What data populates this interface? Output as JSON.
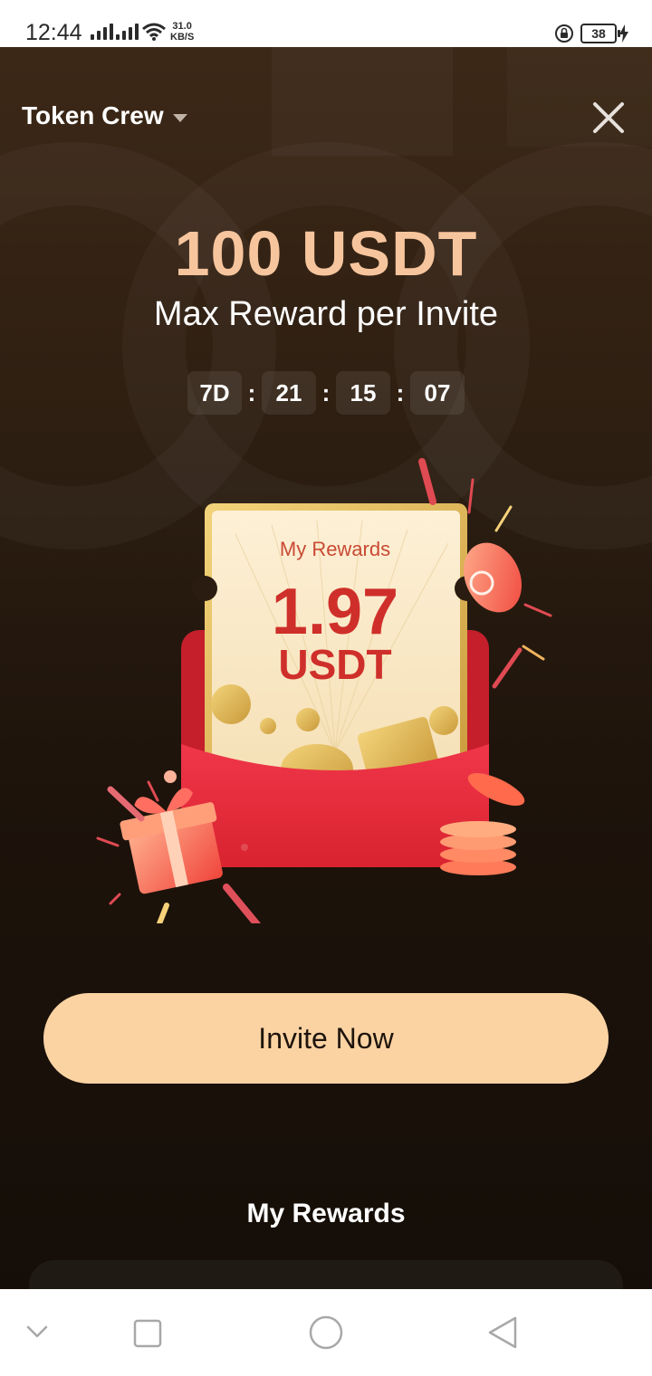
{
  "status_bar": {
    "time": "12:44",
    "speed_value": "31.0",
    "speed_unit": "KB/S",
    "battery": "38"
  },
  "header": {
    "title": "Token Crew"
  },
  "promo": {
    "headline": "100 USDT",
    "subline": "Max Reward per Invite"
  },
  "countdown": {
    "days": "7D",
    "hours": "21",
    "minutes": "15",
    "seconds": "07",
    "separator": ":"
  },
  "reward_ticket": {
    "title": "My Rewards",
    "amount": "1.97",
    "unit": "USDT"
  },
  "actions": {
    "invite_label": "Invite Now"
  },
  "rewards_section": {
    "title": "My Rewards"
  },
  "colors": {
    "accent": "#f7c59d",
    "button": "#fbd3a3",
    "envelope": "#e3283a",
    "ticket_text": "#cf2f2a"
  },
  "icons": {
    "dropdown": "caret-down-icon",
    "close": "close-icon",
    "nav_down": "chevron-down-icon",
    "nav_recent": "square-icon",
    "nav_home": "circle-icon",
    "nav_back": "triangle-back-icon"
  }
}
